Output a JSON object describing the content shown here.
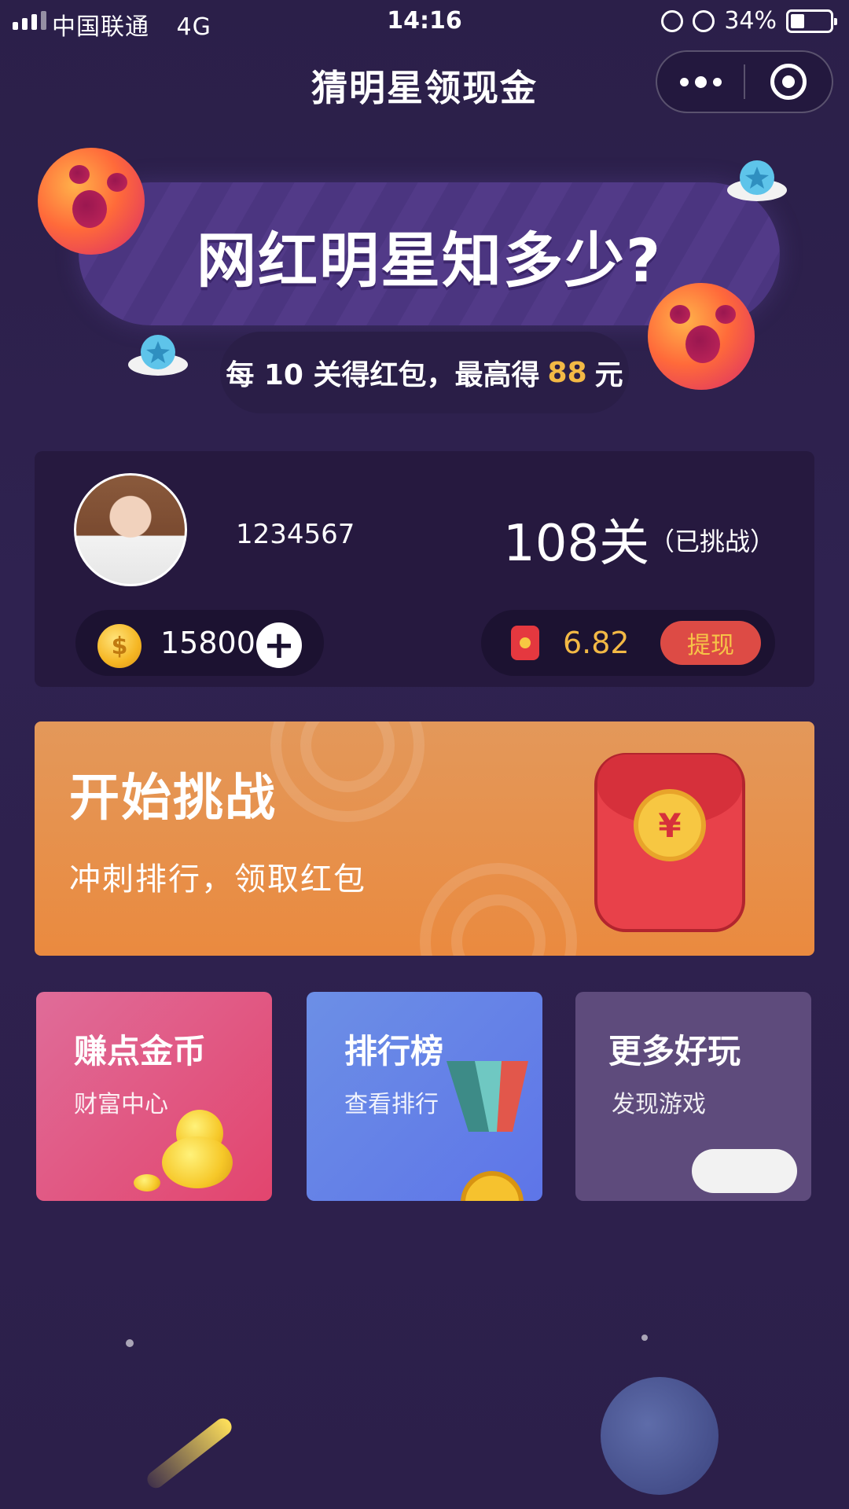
{
  "status_bar": {
    "carrier": "中国联通",
    "network": "4G",
    "time": "14:16",
    "battery": "34%"
  },
  "titlebar": {
    "title": "猜明星领现金"
  },
  "banner": {
    "title": "网红明星知多少?",
    "subtitle_prefix": "每 10 关得红包，最高得",
    "subtitle_amount": "88",
    "subtitle_suffix": "元"
  },
  "user": {
    "id": "1234567",
    "levels": "108关",
    "levels_note": "（已挑战）",
    "coins": "158000",
    "coin_symbol": "$",
    "cash": "6.82",
    "withdraw_label": "提现"
  },
  "challenge": {
    "title": "开始挑战",
    "subtitle": "冲刺排行，领取红包",
    "seal_symbol": "¥"
  },
  "tiles": [
    {
      "title": "赚点金币",
      "subtitle": "财富中心"
    },
    {
      "title": "排行榜",
      "subtitle": "查看排行"
    },
    {
      "title": "更多好玩",
      "subtitle": "发现游戏"
    }
  ],
  "colors": {
    "accent_gold": "#f3b945",
    "background": "#2b1f49",
    "challenge": "#ea8a3f",
    "withdraw": "#dd4b45"
  }
}
